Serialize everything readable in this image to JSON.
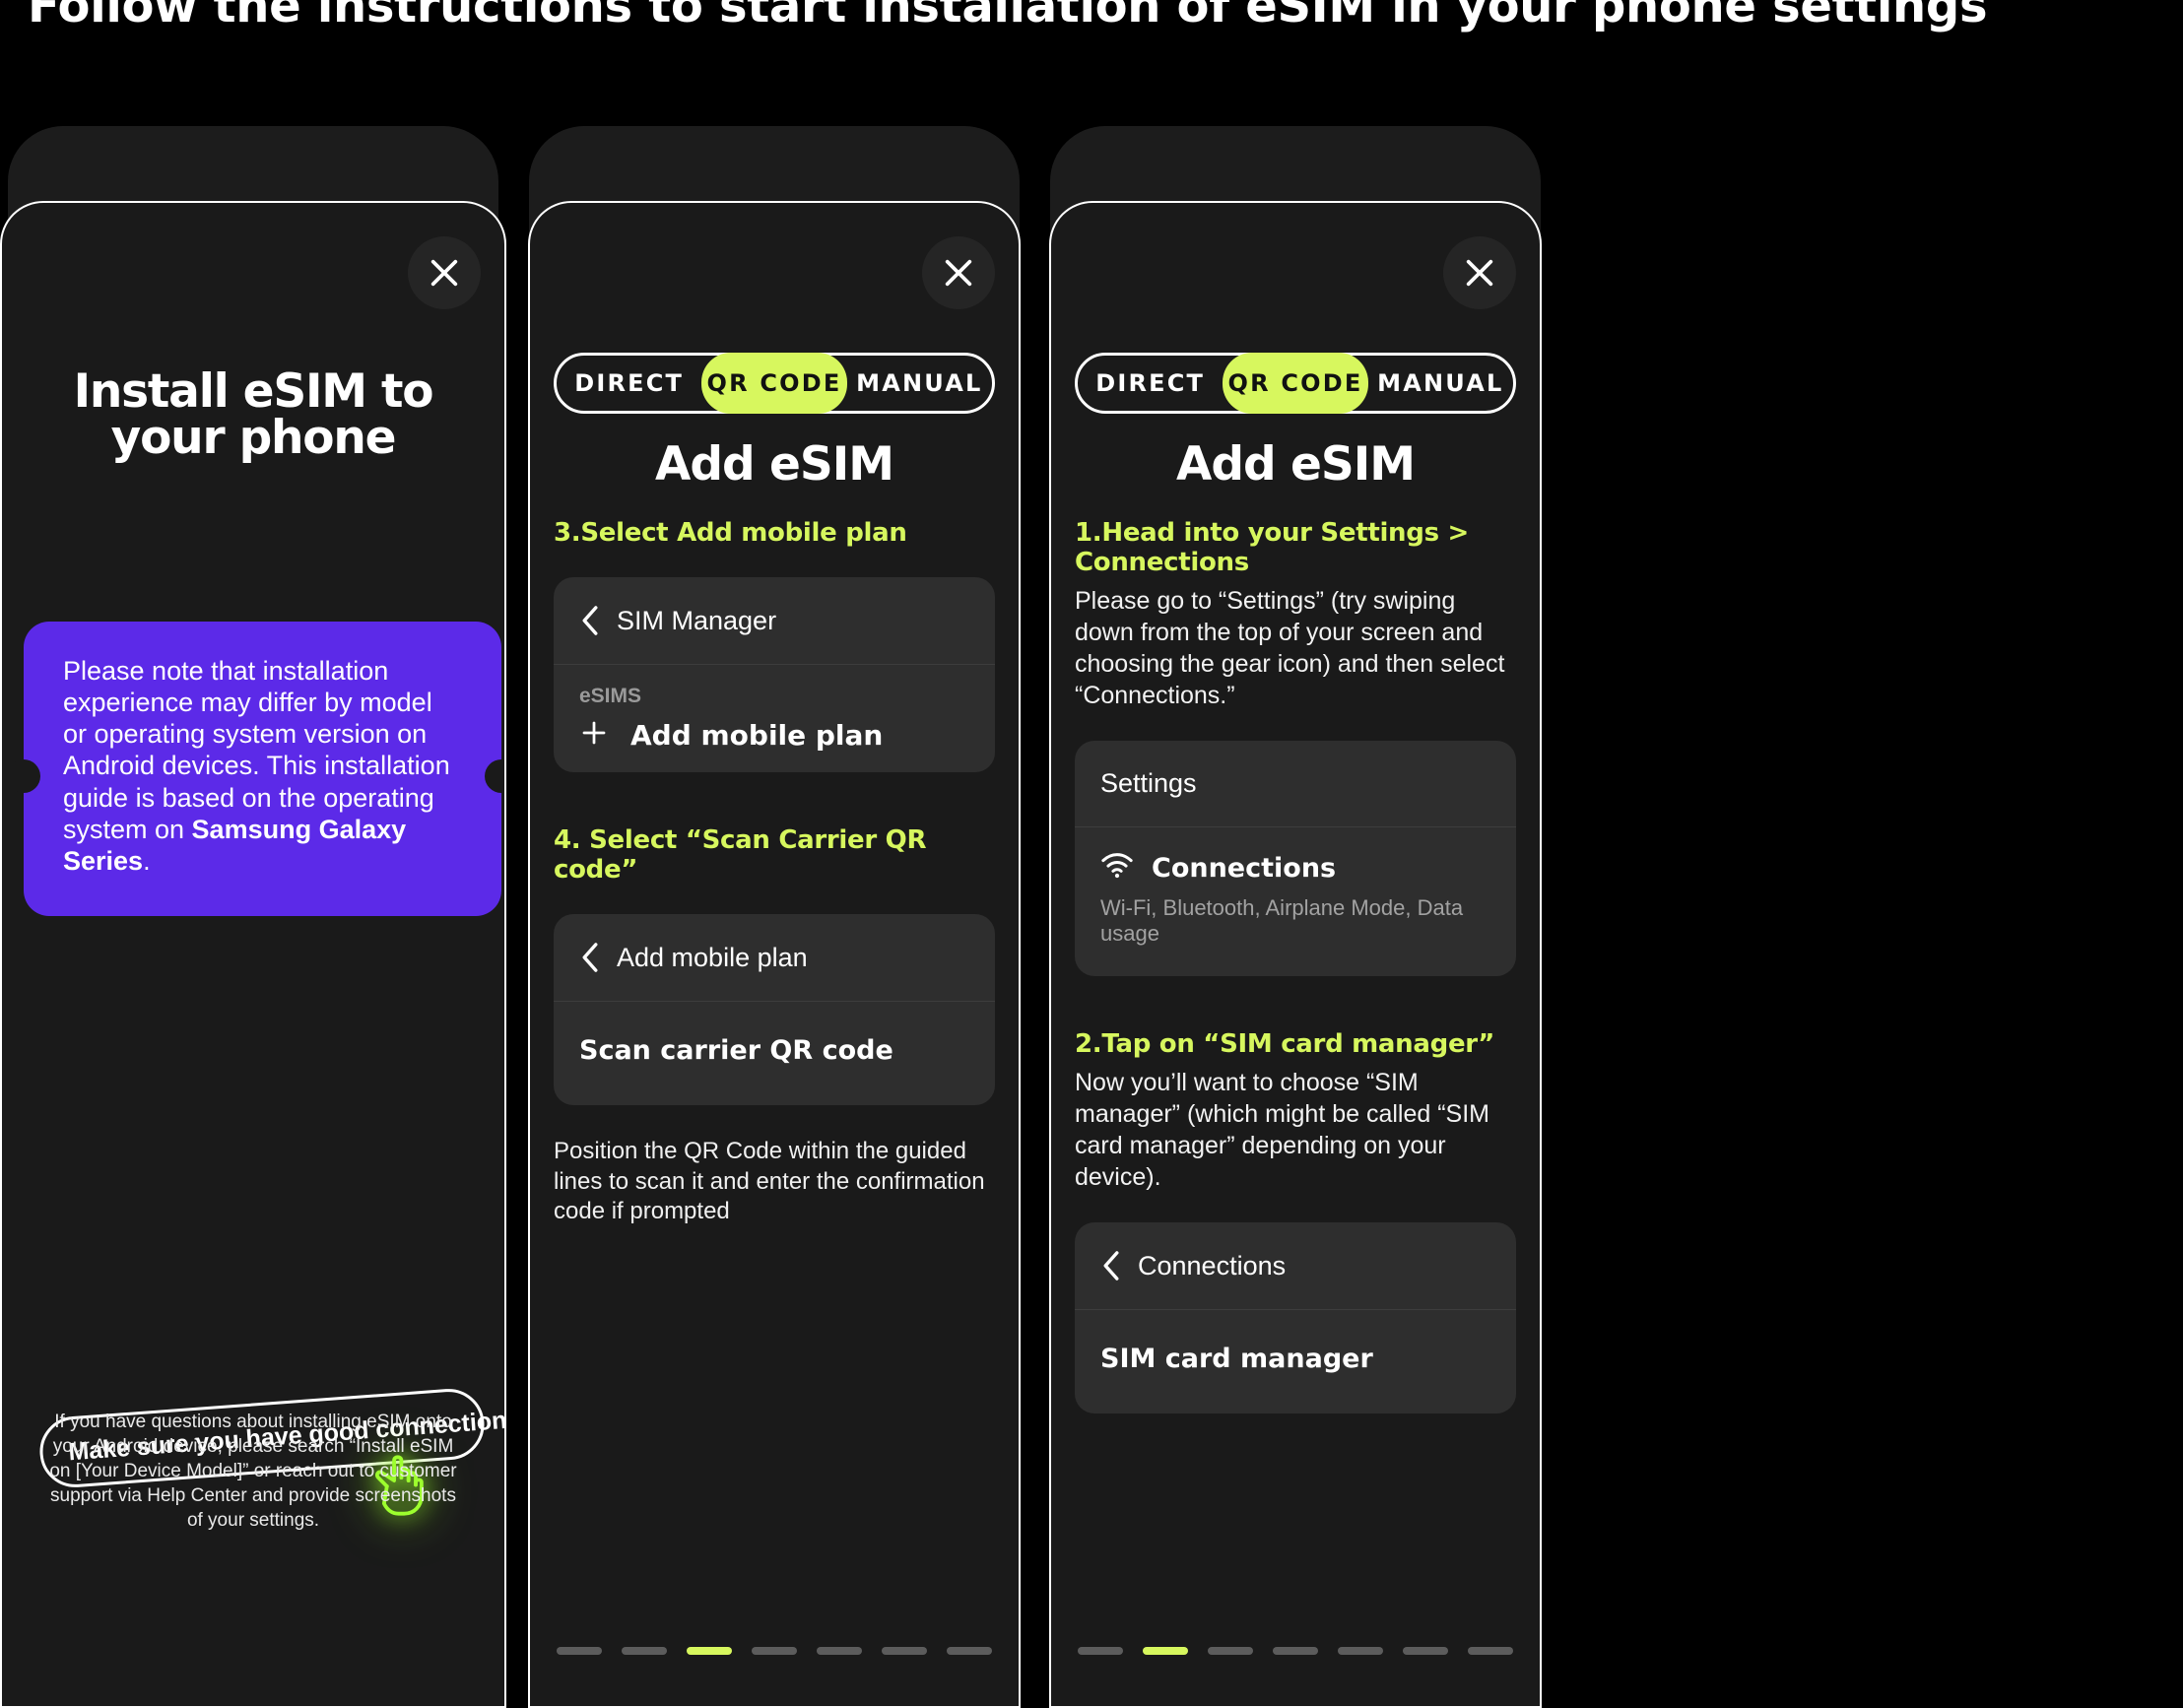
{
  "page": {
    "heading": "Follow the instructions to start installation of eSIM in your phone settings"
  },
  "colors": {
    "accent_lime": "#d7f75e",
    "note_purple": "#5c2ae8",
    "phone_body": "#1c1c1c",
    "sheet_bg": "#1a1a1a",
    "mock_card": "#2e2e2e"
  },
  "phone1": {
    "close_label": "close-icon",
    "title": "Install eSIM to your phone",
    "note": {
      "text_before": "Please note that installation experience may differ by model or operating system version on Android devices. This installation guide is based on the operating system on ",
      "text_bold": "Samsung Galaxy Series",
      "text_after": "."
    },
    "connection_chip": "Make sure you have good connection",
    "footnote": "If you have questions about installing eSIM onto your Android device, please search “Install eSIM on [Your Device Model]” or reach out to customer support via Help Center and provide screenshots of your settings."
  },
  "phone2": {
    "tabs": [
      {
        "label": "DIRECT",
        "active": false
      },
      {
        "label": "QR CODE",
        "active": true
      },
      {
        "label": "MANUAL",
        "active": false
      }
    ],
    "title": "Add eSIM",
    "steps": [
      {
        "head": "3.Select Add mobile plan",
        "body": "",
        "card": {
          "nav_row": "SIM Manager",
          "group_label": "eSIMS",
          "action_row": "Add mobile plan"
        }
      },
      {
        "head": "4. Select “Scan Carrier QR code”",
        "body": "",
        "card": {
          "nav_row": "Add mobile plan",
          "action_row": "Scan carrier QR code"
        }
      }
    ],
    "hint": "Position the QR Code within the guided lines to scan it and enter the confirmation code if prompted",
    "pager": {
      "count": 7,
      "active_index": 2
    }
  },
  "phone3": {
    "tabs": [
      {
        "label": "DIRECT",
        "active": false
      },
      {
        "label": "QR CODE",
        "active": true
      },
      {
        "label": "MANUAL",
        "active": false
      }
    ],
    "title": "Add eSIM",
    "steps": [
      {
        "head": "1.Head into your Settings > Connections",
        "body": "Please go to “Settings” (try swiping down from the top of your screen and choosing the gear icon) and then select “Connections.”",
        "card": {
          "nav_row": "Settings",
          "action_row": "Connections",
          "sub_row": "Wi-Fi, Bluetooth, Airplane Mode, Data usage"
        }
      },
      {
        "head": "2.Tap on “SIM card manager”",
        "body": "Now you’ll want to choose “SIM manager” (which might be called “SIM card manager” depending on your device).",
        "card": {
          "nav_row": "Connections",
          "action_row": "SIM card manager"
        }
      }
    ],
    "pager": {
      "count": 7,
      "active_index": 1
    }
  }
}
